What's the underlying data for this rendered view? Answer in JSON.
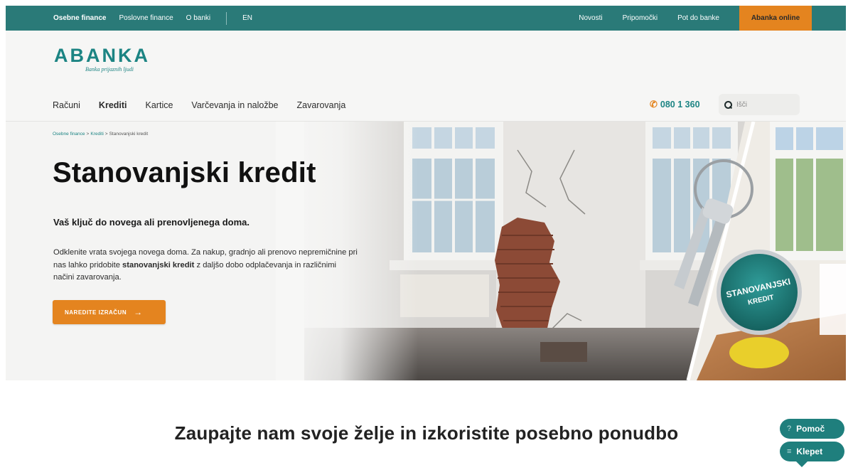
{
  "topbar": {
    "segments": [
      "Osebne finance",
      "Poslovne finance",
      "O banki"
    ],
    "language": "EN",
    "links": [
      "Novosti",
      "Pripomočki",
      "Pot do banke"
    ],
    "online_label": "Abanka online"
  },
  "header": {
    "logo": {
      "word": "ABANKA",
      "tagline": "Banka prijaznih ljudi"
    },
    "nav": [
      "Računi",
      "Krediti",
      "Kartice",
      "Varčevanja in naložbe",
      "Zavarovanja"
    ],
    "phone": "080 1 360",
    "search": {
      "placeholder": "Išči",
      "value": ""
    }
  },
  "breadcrumb": [
    "Osebne finance",
    "Krediti",
    "Stanovanjski kredit"
  ],
  "hero": {
    "title": "Stanovanjski kredit",
    "subtitle": "Vaš ključ do novega ali prenovljenega doma.",
    "text_before": "Odklenite vrata svojega novega doma. Za nakup, gradnjo ali prenovo nepremičnine pri nas lahko pridobite ",
    "text_bold": "stanovanjski kredit",
    "text_after": " z daljšo dobo odplačevanja in različnimi načini zavarovanja.",
    "cta_label": "NAREDITE IZRAČUN",
    "badge_line1": "STANOVANJSKI",
    "badge_line2": "KREDIT"
  },
  "section": {
    "title": "Zaupajte nam svoje želje in izkoristite posebno ponudbo"
  },
  "widgets": {
    "help_icon": "?",
    "help_label": "Pomoč",
    "chat_icon": "≡",
    "chat_label": "Klepet"
  },
  "colors": {
    "brand_teal": "#2a7a78",
    "accent_orange": "#e4841f",
    "page_background": "#f6f6f5"
  }
}
